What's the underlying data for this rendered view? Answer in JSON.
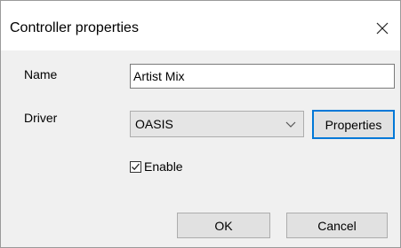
{
  "window": {
    "title": "Controller properties",
    "close_icon": "close-icon"
  },
  "form": {
    "name_label": "Name",
    "name_value": "Artist Mix",
    "driver_label": "Driver",
    "driver_value": "OASIS",
    "driver_arrow_icon": "chevron-down-icon",
    "properties_label": "Properties",
    "enable_label": "Enable",
    "enable_checked": true
  },
  "footer": {
    "ok_label": "OK",
    "cancel_label": "Cancel"
  },
  "colors": {
    "focus_border": "#0078d7",
    "dialog_bg": "#f0f0f0",
    "title_bg": "#ffffff"
  }
}
